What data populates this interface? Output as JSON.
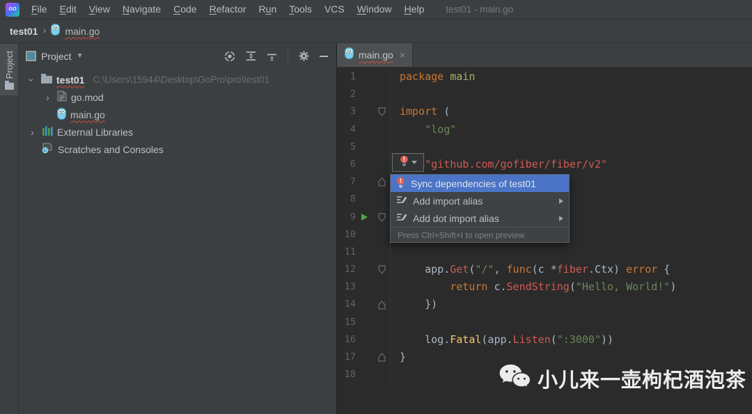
{
  "titlebar": {
    "title": "test01 - main.go",
    "menus": [
      {
        "label": "File",
        "u": 0
      },
      {
        "label": "Edit",
        "u": 0
      },
      {
        "label": "View",
        "u": 0
      },
      {
        "label": "Navigate",
        "u": 0
      },
      {
        "label": "Code",
        "u": 0
      },
      {
        "label": "Refactor",
        "u": 0
      },
      {
        "label": "Run",
        "u": 1
      },
      {
        "label": "Tools",
        "u": 0
      },
      {
        "label": "VCS",
        "u": -1
      },
      {
        "label": "Window",
        "u": 0
      },
      {
        "label": "Help",
        "u": 0
      }
    ]
  },
  "breadcrumb": {
    "project": "test01",
    "file": "main.go"
  },
  "tool_stripe": {
    "project_label": "Project"
  },
  "project_panel": {
    "header": {
      "title": "Project"
    },
    "tree": {
      "root_label": "test01",
      "root_path": "C:\\Users\\15944\\Desktop\\GoPro\\pro\\test01",
      "gomod_label": "go.mod",
      "maingo_label": "main.go",
      "external_label": "External Libraries",
      "scratches_label": "Scratches and Consoles"
    }
  },
  "editor": {
    "tab": {
      "label": "main.go",
      "close": "×"
    },
    "lines": [
      {
        "n": "1",
        "fold": "",
        "run": false,
        "t": [
          [
            "k",
            "package"
          ],
          [
            "d",
            " "
          ],
          [
            "m",
            "main"
          ]
        ]
      },
      {
        "n": "2",
        "fold": "",
        "run": false,
        "t": []
      },
      {
        "n": "3",
        "fold": "open",
        "run": false,
        "t": [
          [
            "k",
            "import"
          ],
          [
            "d",
            " ("
          ]
        ]
      },
      {
        "n": "4",
        "fold": "",
        "run": false,
        "t": [
          [
            "d",
            "    "
          ],
          [
            "s",
            "\"log\""
          ]
        ]
      },
      {
        "n": "5",
        "fold": "",
        "run": false,
        "t": []
      },
      {
        "n": "6",
        "fold": "",
        "run": false,
        "t": [
          [
            "d",
            "    "
          ],
          [
            "e",
            "\"github.com/gofiber/fiber/v2\""
          ]
        ]
      },
      {
        "n": "7",
        "fold": "close",
        "run": false,
        "t": []
      },
      {
        "n": "8",
        "fold": "",
        "run": false,
        "t": []
      },
      {
        "n": "9",
        "fold": "open",
        "run": true,
        "t": []
      },
      {
        "n": "10",
        "fold": "",
        "run": false,
        "t": []
      },
      {
        "n": "11",
        "fold": "",
        "run": false,
        "t": []
      },
      {
        "n": "12",
        "fold": "open",
        "run": false,
        "t": [
          [
            "d",
            "    app."
          ],
          [
            "e",
            "Get"
          ],
          [
            "d",
            "("
          ],
          [
            "s",
            "\"/\""
          ],
          [
            "d",
            ", "
          ],
          [
            "k",
            "func"
          ],
          [
            "d",
            "(c *"
          ],
          [
            "e",
            "fiber"
          ],
          [
            "d",
            ".Ctx) "
          ],
          [
            "k",
            "error"
          ],
          [
            "d",
            " {"
          ]
        ]
      },
      {
        "n": "13",
        "fold": "",
        "run": false,
        "t": [
          [
            "d",
            "        "
          ],
          [
            "k",
            "return"
          ],
          [
            "d",
            " c."
          ],
          [
            "e",
            "SendString"
          ],
          [
            "d",
            "("
          ],
          [
            "s",
            "\"Hello, World!\""
          ],
          [
            "d",
            ")"
          ]
        ]
      },
      {
        "n": "14",
        "fold": "close",
        "run": false,
        "t": [
          [
            "d",
            "    })"
          ]
        ]
      },
      {
        "n": "15",
        "fold": "",
        "run": false,
        "t": []
      },
      {
        "n": "16",
        "fold": "",
        "run": false,
        "t": [
          [
            "d",
            "    log."
          ],
          [
            "f",
            "Fatal"
          ],
          [
            "d",
            "(app."
          ],
          [
            "e",
            "Listen"
          ],
          [
            "d",
            "("
          ],
          [
            "s",
            "\":3000\""
          ],
          [
            "d",
            "))"
          ]
        ]
      },
      {
        "n": "17",
        "fold": "close",
        "run": false,
        "t": [
          [
            "d",
            "}"
          ]
        ]
      },
      {
        "n": "18",
        "fold": "",
        "run": false,
        "t": []
      }
    ]
  },
  "popup": {
    "items": [
      {
        "label": "Sync dependencies of test01",
        "icon": "red-bulb-icon",
        "selected": true
      },
      {
        "label": "Add import alias",
        "icon": "intention-pencil-icon",
        "submenu": true
      },
      {
        "label": "Add dot import alias",
        "icon": "intention-pencil-icon",
        "submenu": true
      }
    ],
    "footer": "Press Ctrl+Shift+I to open preview"
  },
  "watermark": {
    "text": "小儿来一壶枸杞酒泡茶"
  },
  "colors": {
    "panel_bg": "#3c3f41",
    "editor_bg": "#2b2b2b",
    "selection_blue": "#4b74c6",
    "keyword": "#cc7832",
    "string": "#6a8759",
    "unresolved": "#cf5b56",
    "function": "#ffc66d",
    "default_text": "#a9b7c6",
    "squiggle_red": "#cf4b43",
    "run_green": "#4fa54d"
  }
}
